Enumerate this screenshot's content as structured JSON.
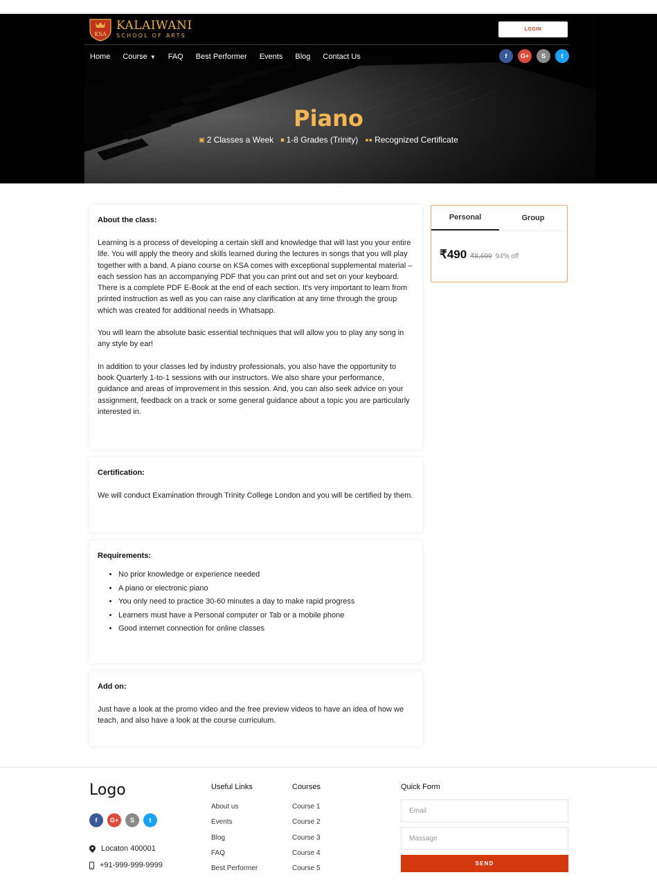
{
  "brand": {
    "name": "KALAIWANI",
    "tagline": "SCHOOL OF ARTS",
    "badge_text": "KSA"
  },
  "header": {
    "login_label": "LOGIN",
    "nav": [
      {
        "label": "Home"
      },
      {
        "label": "Course",
        "has_dropdown": true
      },
      {
        "label": "FAQ"
      },
      {
        "label": "Best Performer"
      },
      {
        "label": "Events"
      },
      {
        "label": "Blog"
      },
      {
        "label": "Contact Us"
      }
    ],
    "socials": [
      {
        "icon": "facebook-icon",
        "glyph": "f"
      },
      {
        "icon": "google-plus-icon",
        "glyph": "G+"
      },
      {
        "icon": "skype-icon",
        "glyph": "S"
      },
      {
        "icon": "twitter-icon",
        "glyph": "t"
      }
    ]
  },
  "hero": {
    "title": "Piano",
    "meta": [
      {
        "icon": "calendar-icon",
        "text": "2 Classes a Week"
      },
      {
        "icon": "book-icon",
        "text": "1-8 Grades (Trinity)"
      },
      {
        "icon": "users-icon",
        "text": "Recognized Certificate"
      }
    ]
  },
  "about": {
    "heading": "About the class:",
    "paragraphs": [
      "Learning is a process of developing a certain skill and knowledge that will last you your entire life. You will apply the theory and skills learned during the lectures in songs that you will play together with a band. A piano course on KSA comes with exceptional supplemental material – each session has an accompanying PDF that you can print out and set on your keyboard. There is a complete PDF E-Book at the end of each section. It's very important to learn from printed instruction as well as you can raise any clarification at any time through the group which was created for additional needs in Whatsapp.",
      "You will learn the absolute basic essential techniques that will allow you to play any song in any style by ear!",
      "In addition to your classes led by industry professionals, you also have the opportunity to book Quarterly 1-to-1 sessions with our instructors. We also share your performance, guidance and areas of improvement in this session. And, you can also seek advice on your assignment, feedback on a track or some general guidance about a topic you are particularly interested in."
    ]
  },
  "certification": {
    "heading": "Certification:",
    "text": "We will conduct Examination through Trinity College London and you will be certified by them."
  },
  "requirements": {
    "heading": "Requirements:",
    "items": [
      "No prior knowledge or experience needed",
      "A piano or electronic piano",
      "You only need to practice 30-60 minutes a day to make rapid progress",
      "Learners must have a Personal computer or Tab or a mobile phone",
      "Good internet connection for online classes"
    ]
  },
  "addon": {
    "heading": "Add on:",
    "text": "Just have a look at the promo video and the free preview videos to have an idea of how we teach, and also have a look at the course curriculum."
  },
  "pricing": {
    "tabs": [
      "Personal",
      "Group"
    ],
    "active_tab": "Personal",
    "price": "₹490",
    "original_price": "₹8,699",
    "discount": "94% off"
  },
  "footer": {
    "logo": "Logo",
    "location": "Locaton 400001",
    "phone": "+91-999-999-9999",
    "useful_links": {
      "heading": "Useful Links",
      "items": [
        "About us",
        "Events",
        "Blog",
        "FAQ",
        "Best Performer"
      ]
    },
    "courses": {
      "heading": "Courses",
      "items": [
        "Course 1",
        "Course 2",
        "Course 3",
        "Course 4",
        "Course 5"
      ]
    },
    "quick_form": {
      "heading": "Quick Form",
      "email_placeholder": "Email",
      "message_placeholder": "Massage",
      "send_label": "SEND"
    }
  },
  "colors": {
    "accent": "#d4380f",
    "gold": "#f2b654",
    "pricing_border": "#f0a46b"
  }
}
